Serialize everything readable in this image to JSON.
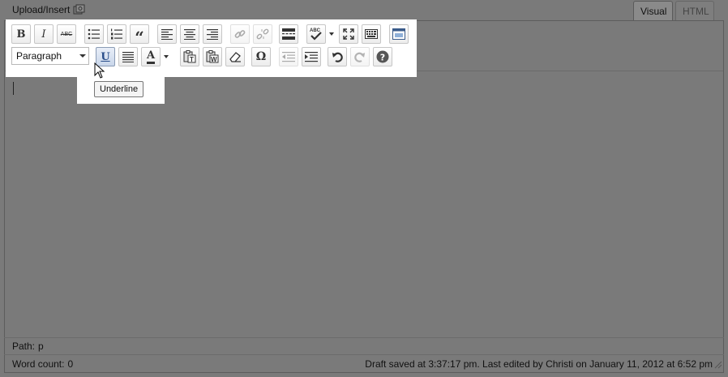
{
  "upload": {
    "label": "Upload/Insert",
    "icon": "media-gallery-icon"
  },
  "tabs": [
    {
      "label": "Visual",
      "active": true
    },
    {
      "label": "HTML",
      "active": false
    }
  ],
  "toolbar": {
    "row1": [
      {
        "name": "bold",
        "glyph": "B"
      },
      {
        "name": "italic",
        "glyph": "I"
      },
      {
        "name": "strikethrough",
        "glyph": "ABC"
      },
      {
        "name": "bullet-list"
      },
      {
        "name": "numbered-list"
      },
      {
        "name": "blockquote",
        "glyph": "“"
      },
      {
        "name": "align-left"
      },
      {
        "name": "align-center"
      },
      {
        "name": "align-right"
      },
      {
        "name": "insert-link",
        "disabled": true
      },
      {
        "name": "remove-link",
        "disabled": true
      },
      {
        "name": "insert-more"
      },
      {
        "name": "spellcheck"
      },
      {
        "name": "fullscreen"
      },
      {
        "name": "kitchen-sink"
      },
      {
        "name": "insert-media"
      }
    ],
    "format_value": "Paragraph",
    "row2": [
      {
        "name": "underline",
        "glyph": "U"
      },
      {
        "name": "justify"
      },
      {
        "name": "text-color",
        "glyph": "A"
      },
      {
        "name": "paste-text"
      },
      {
        "name": "paste-word"
      },
      {
        "name": "remove-formatting"
      },
      {
        "name": "special-character",
        "glyph": "Ω"
      },
      {
        "name": "outdent",
        "disabled": true
      },
      {
        "name": "indent"
      },
      {
        "name": "undo"
      },
      {
        "name": "redo",
        "disabled": true
      },
      {
        "name": "help",
        "glyph": "?"
      }
    ]
  },
  "tooltip": "Underline",
  "path": {
    "label": "Path:",
    "value": "p"
  },
  "status": {
    "word_count_label": "Word count:",
    "word_count": "0",
    "draft_saved": "Draft saved at 3:37:17 pm. Last edited by Christi on January 11, 2012 at 6:52 pm"
  }
}
